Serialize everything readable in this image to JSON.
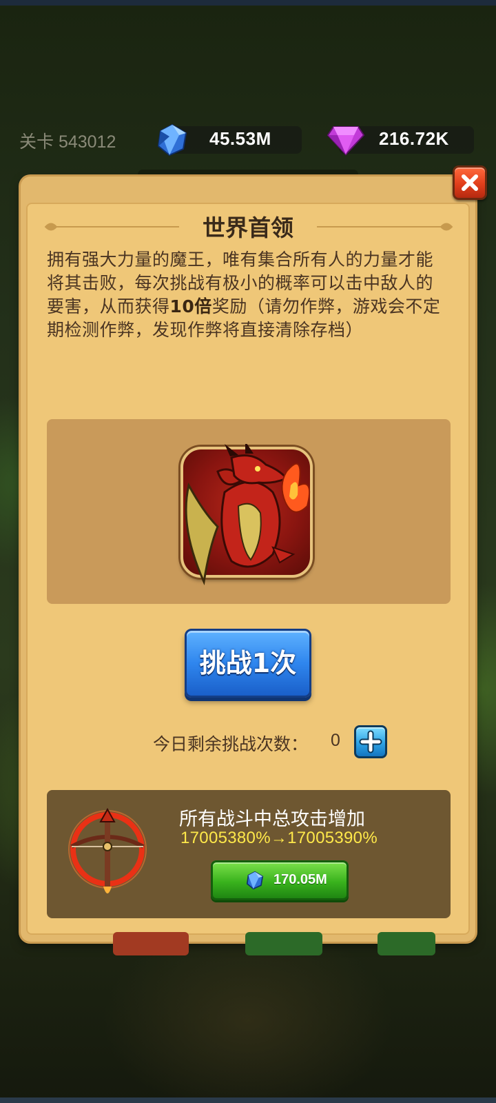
{
  "hud": {
    "level_label": "关卡 543012",
    "crystal_value": "45.53M",
    "gem_value": "216.72K"
  },
  "dialog": {
    "title": "世界首领",
    "description_part1": "拥有强大力量的魔王，唯有集合所有人的力量才能将其击败，每次挑战有极小的概率可以击中敌人的要害，从而获得",
    "description_bold": "10倍",
    "description_part2": "奖励（请勿作弊，游戏会不定期检测作弊，发现作弊将直接清除存档）",
    "challenge_button": "挑战1次",
    "remaining_label": "今日剩余挑战次数：",
    "remaining_count": "0",
    "upgrade": {
      "title": "所有战斗中总攻击增加",
      "values": "17005380%→17005390%",
      "cost": "170.05M"
    }
  },
  "colors": {
    "dialog_bg": "#efc778",
    "challenge_blue": "#2f86ee",
    "upgrade_green": "#39b21d",
    "upgrade_value_yellow": "#ffe94a",
    "close_red": "#e13e1b"
  },
  "icons": [
    "crystal-icon",
    "gem-icon",
    "close-icon",
    "dragon-boss-portrait",
    "plus-icon",
    "crossbow-icon"
  ]
}
